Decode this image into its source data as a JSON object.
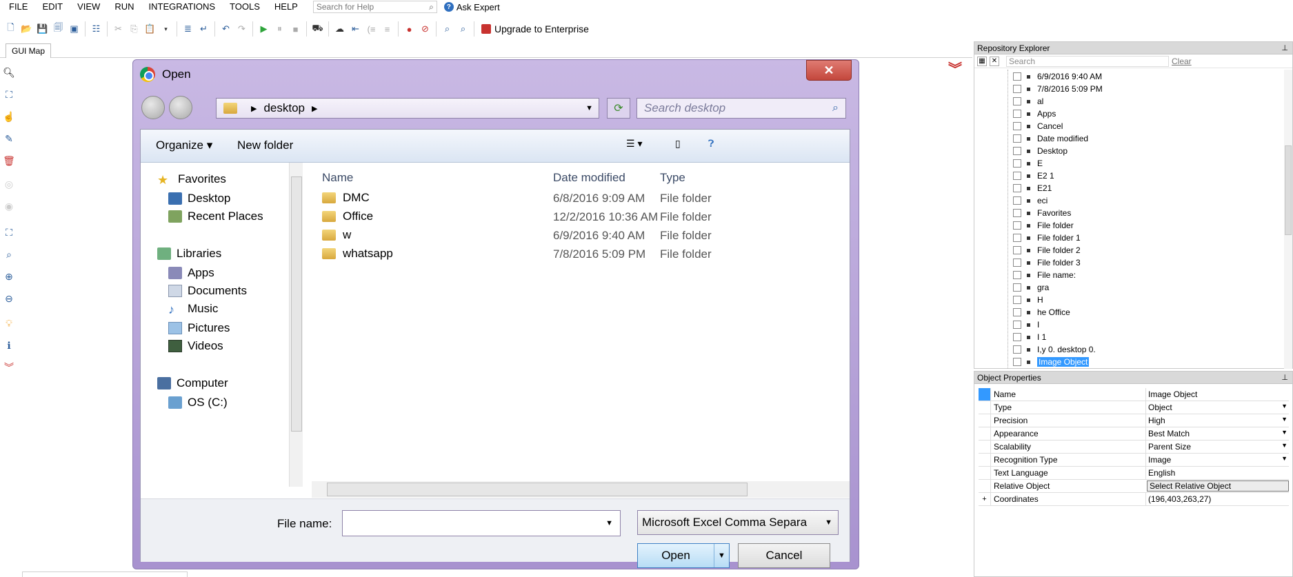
{
  "menu": [
    "FILE",
    "EDIT",
    "VIEW",
    "RUN",
    "INTEGRATIONS",
    "TOOLS",
    "HELP"
  ],
  "search_help": {
    "placeholder": "Search for Help"
  },
  "ask_expert": "Ask Expert",
  "upgrade": "Upgrade to Enterprise",
  "tab": "GUI Map",
  "dialog": {
    "title": "Open",
    "close_glyph": "✕",
    "address": "desktop",
    "search_placeholder": "Search desktop",
    "organize": "Organize ▾",
    "new_folder": "New folder",
    "nav": {
      "favorites": "Favorites",
      "desktop": "Desktop",
      "recent": "Recent Places",
      "libraries": "Libraries",
      "apps": "Apps",
      "documents": "Documents",
      "music": "Music",
      "pictures": "Pictures",
      "videos": "Videos",
      "computer": "Computer",
      "os": "OS (C:)"
    },
    "columns": {
      "name": "Name",
      "date": "Date modified",
      "type": "Type"
    },
    "files": [
      {
        "name": "DMC",
        "date": "6/8/2016 9:09 AM",
        "type": "File folder"
      },
      {
        "name": "Office",
        "date": "12/2/2016 10:36 AM",
        "type": "File folder"
      },
      {
        "name": "w",
        "date": "6/9/2016 9:40 AM",
        "type": "File folder"
      },
      {
        "name": "whatsapp",
        "date": "7/8/2016 5:09 PM",
        "type": "File folder"
      }
    ],
    "file_name_label": "File name:",
    "filter": "Microsoft Excel Comma Separa",
    "open_button": "Open",
    "cancel_button": "Cancel"
  },
  "repository": {
    "title": "Repository Explorer",
    "search_placeholder": "Search",
    "clear": "Clear",
    "items": [
      "6/9/2016 9:40 AM",
      "7/8/2016 5:09 PM",
      "al",
      "Apps",
      "Cancel",
      "Date modified",
      "Desktop",
      "E",
      "E2 1",
      "E21",
      "eci",
      "Favorites",
      "File folder",
      "File folder 1",
      "File folder 2",
      "File folder 3",
      "File name:",
      "gra",
      "H",
      "he Office",
      "I",
      "I 1",
      "I,y 0. desktop 0.",
      "Image Object"
    ]
  },
  "properties": {
    "title": "Object Properties",
    "rows": [
      {
        "key": "Name",
        "value": "Image Object"
      },
      {
        "key": "Type",
        "value": "Object"
      },
      {
        "key": "Precision",
        "value": "High"
      },
      {
        "key": "Appearance",
        "value": "Best Match"
      },
      {
        "key": "Scalability",
        "value": "Parent Size"
      },
      {
        "key": "Recognition Type",
        "value": "Image"
      },
      {
        "key": "Text Language",
        "value": "English"
      },
      {
        "key": "Relative Object",
        "value": "Select Relative Object"
      },
      {
        "key": "Coordinates",
        "value": "(196,403,263,27)"
      }
    ],
    "expand_glyph": "+"
  },
  "colors": {
    "accent": "#3399ff",
    "brand_red": "#c8322f",
    "dialog_frame": "#a892cf"
  }
}
